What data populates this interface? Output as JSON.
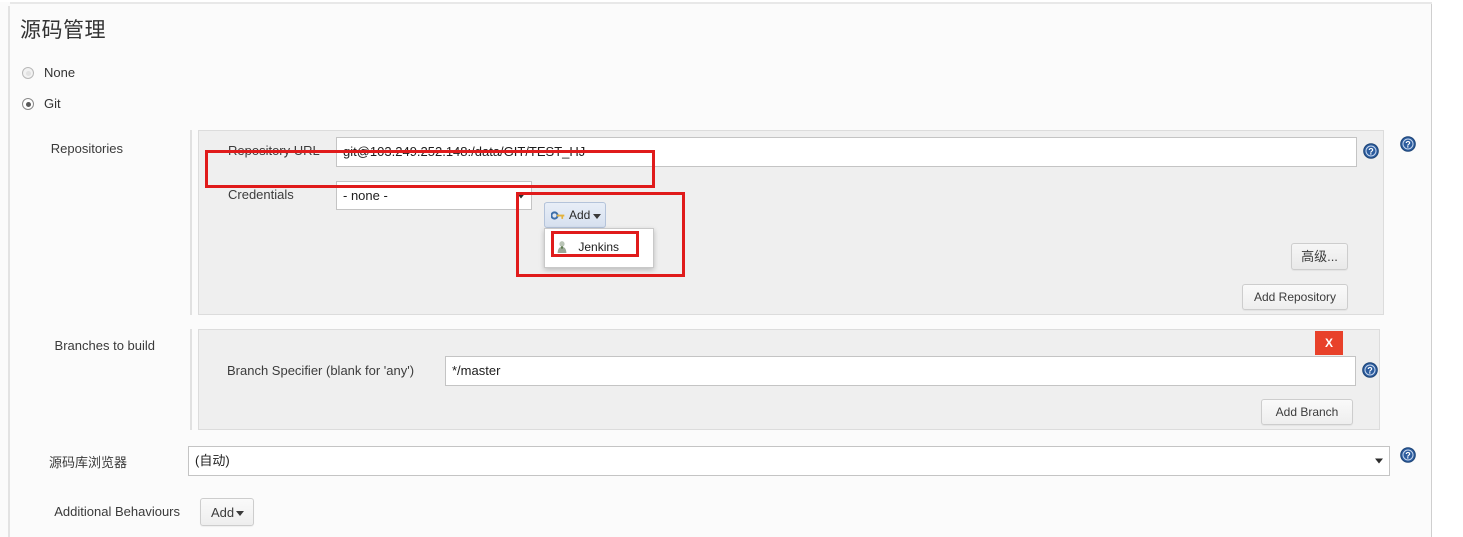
{
  "page": {
    "title": "源码管理"
  },
  "scm_type": {
    "options": [
      {
        "label": "None",
        "selected": false
      },
      {
        "label": "Git",
        "selected": true
      }
    ]
  },
  "repositories": {
    "label": "Repositories",
    "repository_url": {
      "label": "Repository URL",
      "value": "git@103.249.252.148:/data/GIT/TEST_HJ",
      "help_icon": "help-icon"
    },
    "credentials": {
      "label": "Credentials",
      "selected": "- none -",
      "dropdown_icon": "chevron-down-icon",
      "add_button": {
        "label": "Add",
        "icon": "key-icon",
        "caret_icon": "chevron-down-icon"
      },
      "menu": {
        "items": [
          {
            "label": "Jenkins",
            "icon": "jenkins-butler-icon"
          }
        ]
      }
    },
    "advanced_button": "高级...",
    "add_repository_button": "Add Repository",
    "section_help_icon": "help-icon"
  },
  "branches": {
    "label": "Branches to build",
    "branch_specifier": {
      "label": "Branch Specifier (blank for 'any')",
      "value": "*/master",
      "help_icon": "help-icon"
    },
    "delete_button": "X",
    "add_branch_button": "Add Branch"
  },
  "repository_browser": {
    "label": "源码库浏览器",
    "selected": "(自动)",
    "dropdown_icon": "chevron-down-icon",
    "help_icon": "help-icon"
  },
  "additional_behaviours": {
    "label": "Additional Behaviours",
    "add_button": {
      "label": "Add",
      "caret_icon": "chevron-down-icon"
    }
  },
  "colors": {
    "annotation": "#e01b1b",
    "delete": "#e8412a",
    "help": "#2c5c9e",
    "panel": "#efefef"
  }
}
